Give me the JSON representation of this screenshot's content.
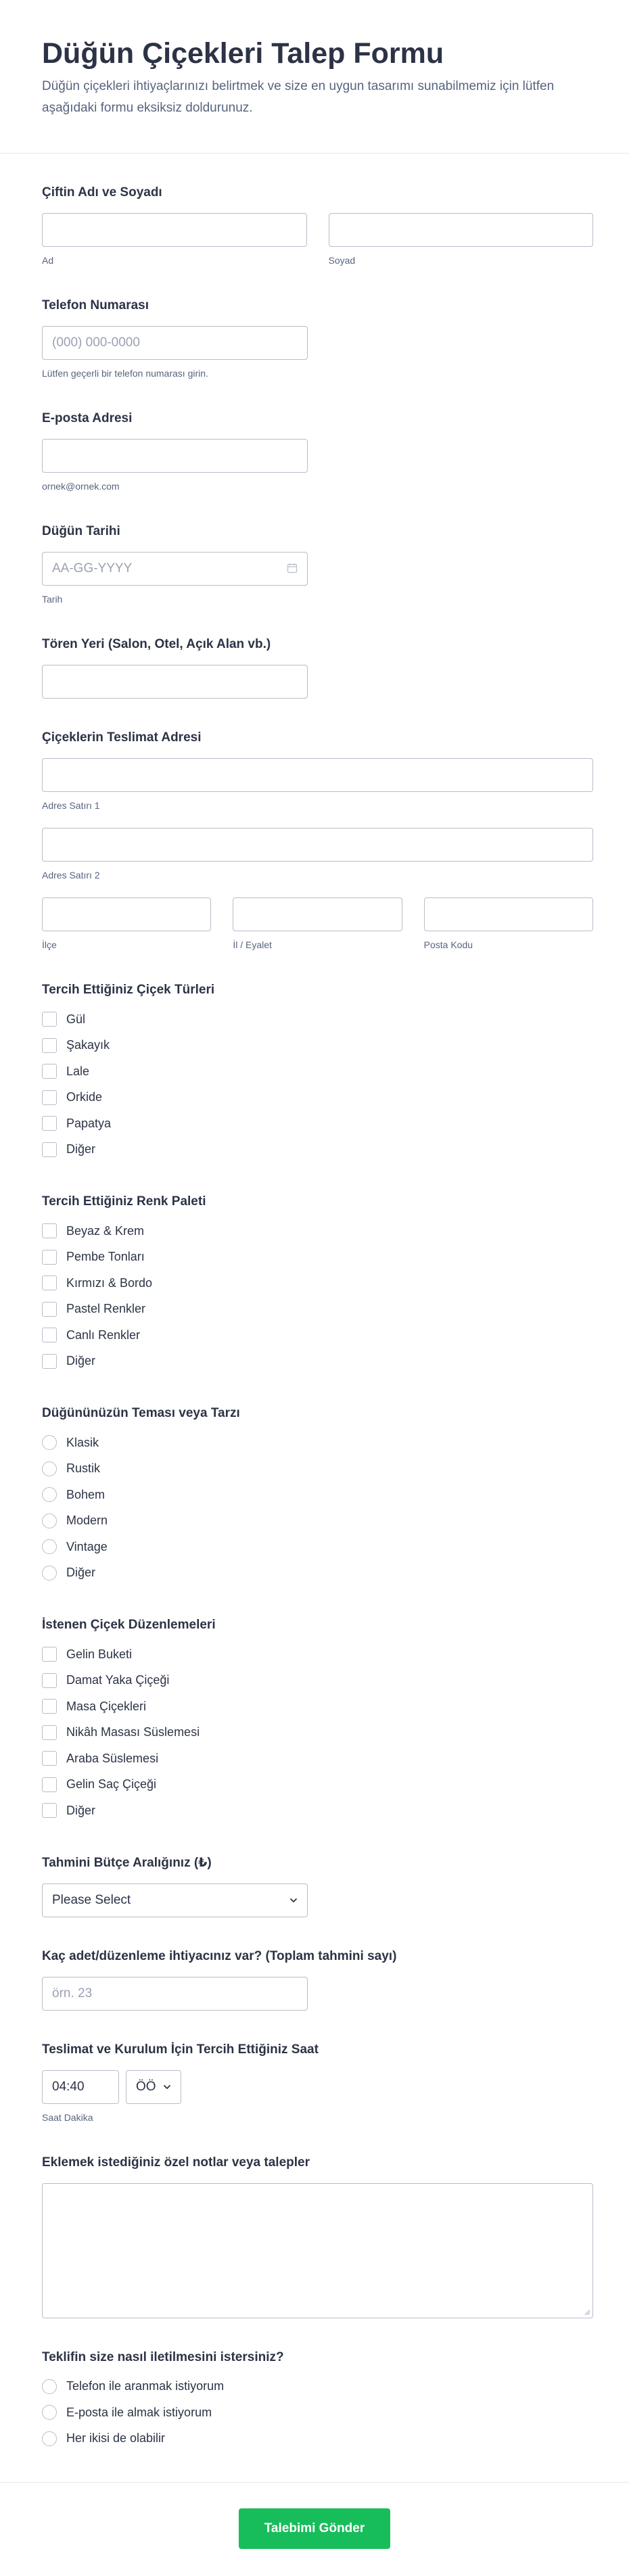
{
  "header": {
    "title": "Düğün Çiçekleri Talep Formu",
    "subtitle": "Düğün çiçekleri ihtiyaçlarınızı belirtmek ve size en uygun tasarımı sunabilmemiz için lütfen aşağıdaki formu eksiksiz doldurunuz."
  },
  "name": {
    "label": "Çiftin Adı ve Soyadı",
    "first_sub": "Ad",
    "last_sub": "Soyad"
  },
  "phone": {
    "label": "Telefon Numarası",
    "placeholder": "(000) 000-0000",
    "sub": "Lütfen geçerli bir telefon numarası girin."
  },
  "email": {
    "label": "E-posta Adresi",
    "sub": "ornek@ornek.com"
  },
  "date": {
    "label": "Düğün Tarihi",
    "placeholder": "AA-GG-YYYY",
    "sub": "Tarih"
  },
  "venue": {
    "label": "Tören Yeri (Salon, Otel, Açık Alan vb.)"
  },
  "address": {
    "label": "Çiçeklerin Teslimat Adresi",
    "line1_sub": "Adres Satırı 1",
    "line2_sub": "Adres Satırı 2",
    "district_sub": "İlçe",
    "city_sub": "İl / Eyalet",
    "zip_sub": "Posta Kodu"
  },
  "flowers": {
    "label": "Tercih Ettiğiniz Çiçek Türleri",
    "options": [
      "Gül",
      "Şakayık",
      "Lale",
      "Orkide",
      "Papatya",
      "Diğer"
    ]
  },
  "colors": {
    "label": "Tercih Ettiğiniz Renk Paleti",
    "options": [
      "Beyaz & Krem",
      "Pembe Tonları",
      "Kırmızı & Bordo",
      "Pastel Renkler",
      "Canlı Renkler",
      "Diğer"
    ]
  },
  "theme": {
    "label": "Düğününüzün Teması veya Tarzı",
    "options": [
      "Klasik",
      "Rustik",
      "Bohem",
      "Modern",
      "Vintage",
      "Diğer"
    ]
  },
  "arrangements": {
    "label": "İstenen Çiçek Düzenlemeleri",
    "options": [
      "Gelin Buketi",
      "Damat Yaka Çiçeği",
      "Masa Çiçekleri",
      "Nikâh Masası Süslemesi",
      "Araba Süslemesi",
      "Gelin Saç Çiçeği",
      "Diğer"
    ]
  },
  "budget": {
    "label": "Tahmini Bütçe Aralığınız (₺)",
    "value": "Please Select"
  },
  "quantity": {
    "label": "Kaç adet/düzenleme ihtiyacınız var? (Toplam tahmini sayı)",
    "placeholder": "örn. 23"
  },
  "time": {
    "label": "Teslimat ve Kurulum İçin Tercih Ettiğiniz Saat",
    "value": "04:40",
    "ampm": "ÖÖ",
    "sub": "Saat Dakika"
  },
  "notes": {
    "label": "Eklemek istediğiniz özel notlar veya talepler"
  },
  "contact": {
    "label": "Teklifin size nasıl iletilmesini istersiniz?",
    "options": [
      "Telefon ile aranmak istiyorum",
      "E-posta ile almak istiyorum",
      "Her ikisi de olabilir"
    ]
  },
  "submit": {
    "label": "Talebimi Gönder",
    "color": "#18bd5b"
  }
}
